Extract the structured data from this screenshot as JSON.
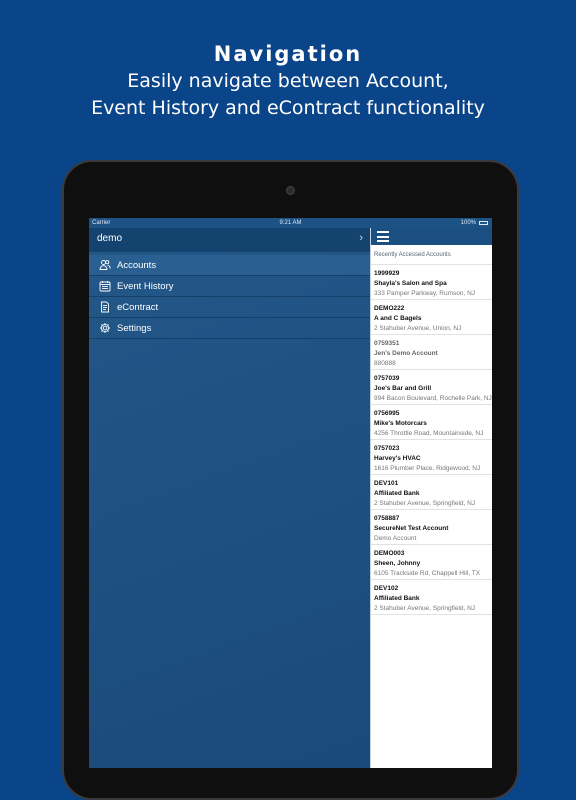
{
  "promo": {
    "title": "Navigation",
    "subtitle_line1": "Easily navigate between Account,",
    "subtitle_line2": "Event History and eContract functionality"
  },
  "status_bar": {
    "carrier": "Carrier",
    "time": "9:21 AM",
    "battery": "100%"
  },
  "menu": {
    "user": "demo",
    "chevron": "›",
    "items": [
      {
        "label": "Accounts",
        "icon": "people-icon",
        "active": true
      },
      {
        "label": "Event History",
        "icon": "calendar-icon",
        "active": false
      },
      {
        "label": "eContract",
        "icon": "document-icon",
        "active": false
      },
      {
        "label": "Settings",
        "icon": "gear-icon",
        "active": false
      }
    ]
  },
  "list": {
    "section_title": "Recently Accessed Accounts",
    "accounts": [
      {
        "code": "1999929",
        "name": "Shayla's Salon and Spa",
        "address": "333 Pamper Parkway, Rumson, NJ"
      },
      {
        "code": "DEMO222",
        "name": "A and C Bagels",
        "address": "2 Stahuber Avenue, Union, NJ"
      },
      {
        "code": "0759351",
        "name": "Jen's Demo Account",
        "address": "880888"
      },
      {
        "code": "0757039",
        "name": "Joe's Bar and Grill",
        "address": "994 Bacon Boulevard, Rochelle Park, NJ"
      },
      {
        "code": "0756995",
        "name": "Mike's Motorcars",
        "address": "4256 Throttle Road, Mountainside, NJ"
      },
      {
        "code": "0757023",
        "name": "Harvey's HVAC",
        "address": "1616 Plumber Place, Ridgewood, NJ"
      },
      {
        "code": "DEV101",
        "name": "Affiliated Bank",
        "address": "2 Stahuber Avenue, Springfield, NJ"
      },
      {
        "code": "0758887",
        "name": "SecureNet Test Account",
        "address": "Demo Account"
      },
      {
        "code": "DEMO003",
        "name": "Sheen, Johnny",
        "address": "6105 Trackside Rd, Chappell Hill, TX"
      },
      {
        "code": "DEV102",
        "name": "Affiliated Bank",
        "address": "2 Stahuber Avenue, Springfield, NJ"
      }
    ]
  },
  "colors": {
    "background": "#0b4589",
    "menu": "#1d4f80",
    "header": "#15436f"
  }
}
